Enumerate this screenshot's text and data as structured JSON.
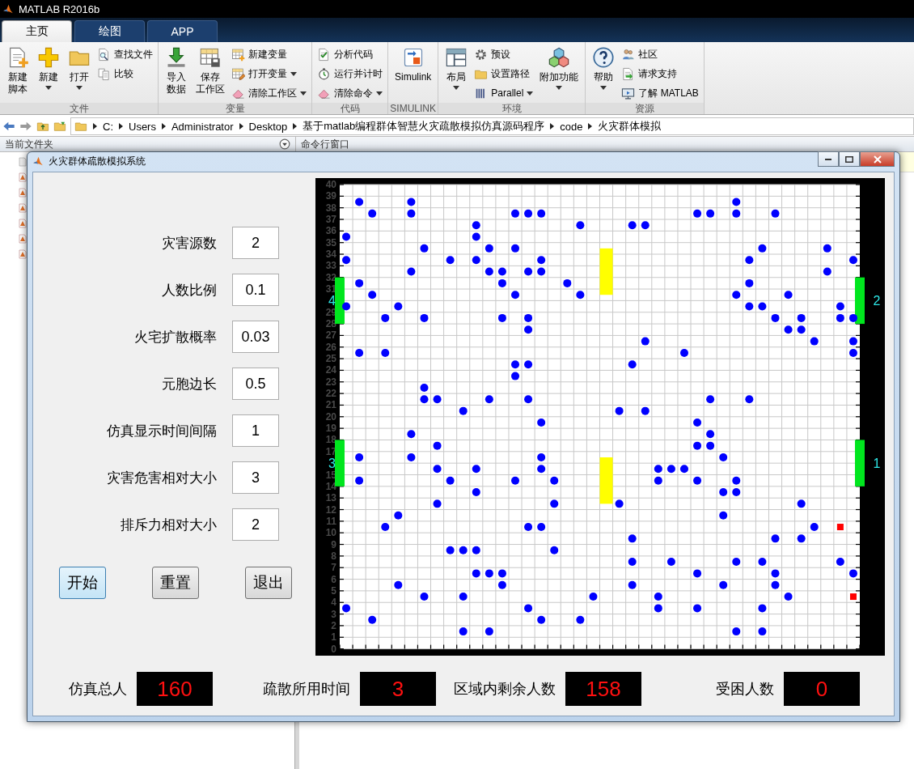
{
  "app_title": "MATLAB R2016b",
  "ribbon_tabs": [
    {
      "label": "主页",
      "selected": true
    },
    {
      "label": "绘图",
      "selected": false
    },
    {
      "label": "APP",
      "selected": false
    }
  ],
  "ribbon_groups": [
    {
      "label": "文件",
      "columns": [
        [
          {
            "kind": "large",
            "lines": [
              "新建",
              "脚本"
            ],
            "dropdown": false
          }
        ],
        [
          {
            "kind": "large",
            "lines": [
              "新建"
            ],
            "dropdown": true
          }
        ],
        [
          {
            "kind": "large",
            "lines": [
              "打开"
            ],
            "dropdown": true
          }
        ],
        [
          {
            "kind": "small",
            "lines": [
              "查找文件"
            ],
            "dropdown": false
          },
          {
            "kind": "small",
            "lines": [
              "比较"
            ],
            "dropdown": false
          }
        ]
      ]
    },
    {
      "label": "变量",
      "columns": [
        [
          {
            "kind": "large",
            "lines": [
              "导入",
              "数据"
            ],
            "dropdown": false
          }
        ],
        [
          {
            "kind": "large",
            "lines": [
              "保存",
              "工作区"
            ],
            "dropdown": false
          }
        ],
        [
          {
            "kind": "small",
            "lines": [
              "新建变量"
            ],
            "dropdown": false
          },
          {
            "kind": "small",
            "lines": [
              "打开变量"
            ],
            "dropdown": true
          },
          {
            "kind": "small",
            "lines": [
              "清除工作区"
            ],
            "dropdown": true
          }
        ]
      ]
    },
    {
      "label": "代码",
      "columns": [
        [
          {
            "kind": "small",
            "lines": [
              "分析代码"
            ],
            "dropdown": false
          },
          {
            "kind": "small",
            "lines": [
              "运行并计时"
            ],
            "dropdown": false
          },
          {
            "kind": "small",
            "lines": [
              "清除命令"
            ],
            "dropdown": true
          }
        ]
      ]
    },
    {
      "label": "SIMULINK",
      "columns": [
        [
          {
            "kind": "large",
            "lines": [
              "Simulink"
            ],
            "dropdown": false
          }
        ]
      ]
    },
    {
      "label": "环境",
      "columns": [
        [
          {
            "kind": "large",
            "lines": [
              "布局"
            ],
            "dropdown": true
          }
        ],
        [
          {
            "kind": "small",
            "lines": [
              "预设"
            ],
            "dropdown": false
          },
          {
            "kind": "small",
            "lines": [
              "设置路径"
            ],
            "dropdown": false
          },
          {
            "kind": "small",
            "lines": [
              "Parallel"
            ],
            "dropdown": true
          }
        ],
        [
          {
            "kind": "large",
            "lines": [
              "附加功能"
            ],
            "dropdown": true
          }
        ]
      ]
    },
    {
      "label": "资源",
      "columns": [
        [
          {
            "kind": "large",
            "lines": [
              "帮助"
            ],
            "dropdown": true
          }
        ],
        [
          {
            "kind": "small",
            "lines": [
              "社区"
            ],
            "dropdown": false
          },
          {
            "kind": "small",
            "lines": [
              "请求支持"
            ],
            "dropdown": false
          },
          {
            "kind": "small",
            "lines": [
              "了解 MATLAB"
            ],
            "dropdown": false
          }
        ]
      ]
    }
  ],
  "path": [
    "C:",
    "Users",
    "Administrator",
    "Desktop",
    "基于matlab编程群体智慧火灾疏散模拟仿真源码程序",
    "code",
    "火灾群体模拟"
  ],
  "panels": {
    "left_title": "当前文件夹",
    "right_title": "命令行窗口"
  },
  "figure": {
    "title": "火灾群体疏散模拟系统",
    "params": [
      {
        "label": "灾害源数",
        "value": "2"
      },
      {
        "label": "人数比例",
        "value": "0.1"
      },
      {
        "label": "火宅扩散概率",
        "value": "0.03"
      },
      {
        "label": "元胞边长",
        "value": "0.5"
      },
      {
        "label": "仿真显示时间间隔",
        "value": "1"
      },
      {
        "label": "灾害危害相对大小",
        "value": "3"
      },
      {
        "label": "排斥力相对大小",
        "value": "2"
      }
    ],
    "buttons": [
      {
        "label": "开始",
        "focused": true
      },
      {
        "label": "重置",
        "focused": false
      },
      {
        "label": "退出",
        "focused": false
      }
    ],
    "grid": {
      "row_labels": [
        "40",
        "39",
        "38",
        "37",
        "36",
        "35",
        "34",
        "33",
        "32",
        "31",
        "29",
        "28",
        "27",
        "26",
        "25",
        "24",
        "23",
        "22",
        "21",
        "20",
        "19",
        "18",
        "17",
        "15",
        "14",
        "13",
        "12",
        "11",
        "10",
        "9",
        "8",
        "7",
        "6",
        "5",
        "4",
        "3",
        "2",
        "1",
        "0"
      ],
      "exit_labels": [
        "4",
        "2",
        "3",
        "1"
      ]
    },
    "stats": [
      {
        "label": "仿真总人",
        "value": "160"
      },
      {
        "label": "疏散所用时间",
        "value": "3"
      },
      {
        "label": "区域内剩余人数",
        "value": "158"
      },
      {
        "label": "受困人数",
        "value": "0"
      }
    ]
  }
}
